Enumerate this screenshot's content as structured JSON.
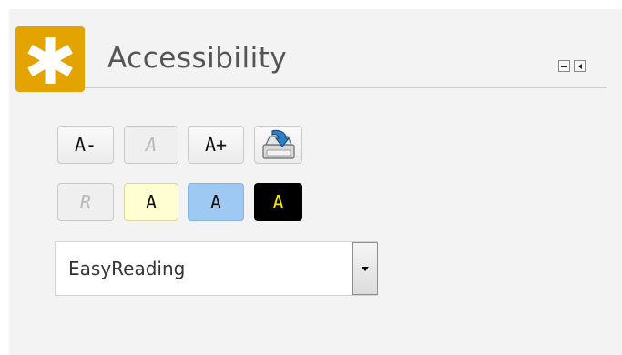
{
  "widget": {
    "title": "Accessibility",
    "logo_glyph": "✱",
    "logo_icon": "asterisk-icon",
    "accent_color": "#e3a300"
  },
  "window_controls": {
    "minimize_icon": "minimize-icon",
    "collapse_icon": "collapse-left-icon"
  },
  "font_size_buttons": {
    "decrease_label": "A-",
    "reset_label": "A",
    "increase_label": "A+",
    "save_icon": "save-settings-icon"
  },
  "contrast_buttons": {
    "reset_label": "R",
    "yellow_label": "A",
    "blue_label": "A",
    "black_label": "A",
    "yellow_bg": "#fffed0",
    "blue_bg": "#9ec9f3",
    "black_bg": "#000000",
    "black_fg": "#f5ea00"
  },
  "font_select": {
    "selected": "EasyReading"
  }
}
